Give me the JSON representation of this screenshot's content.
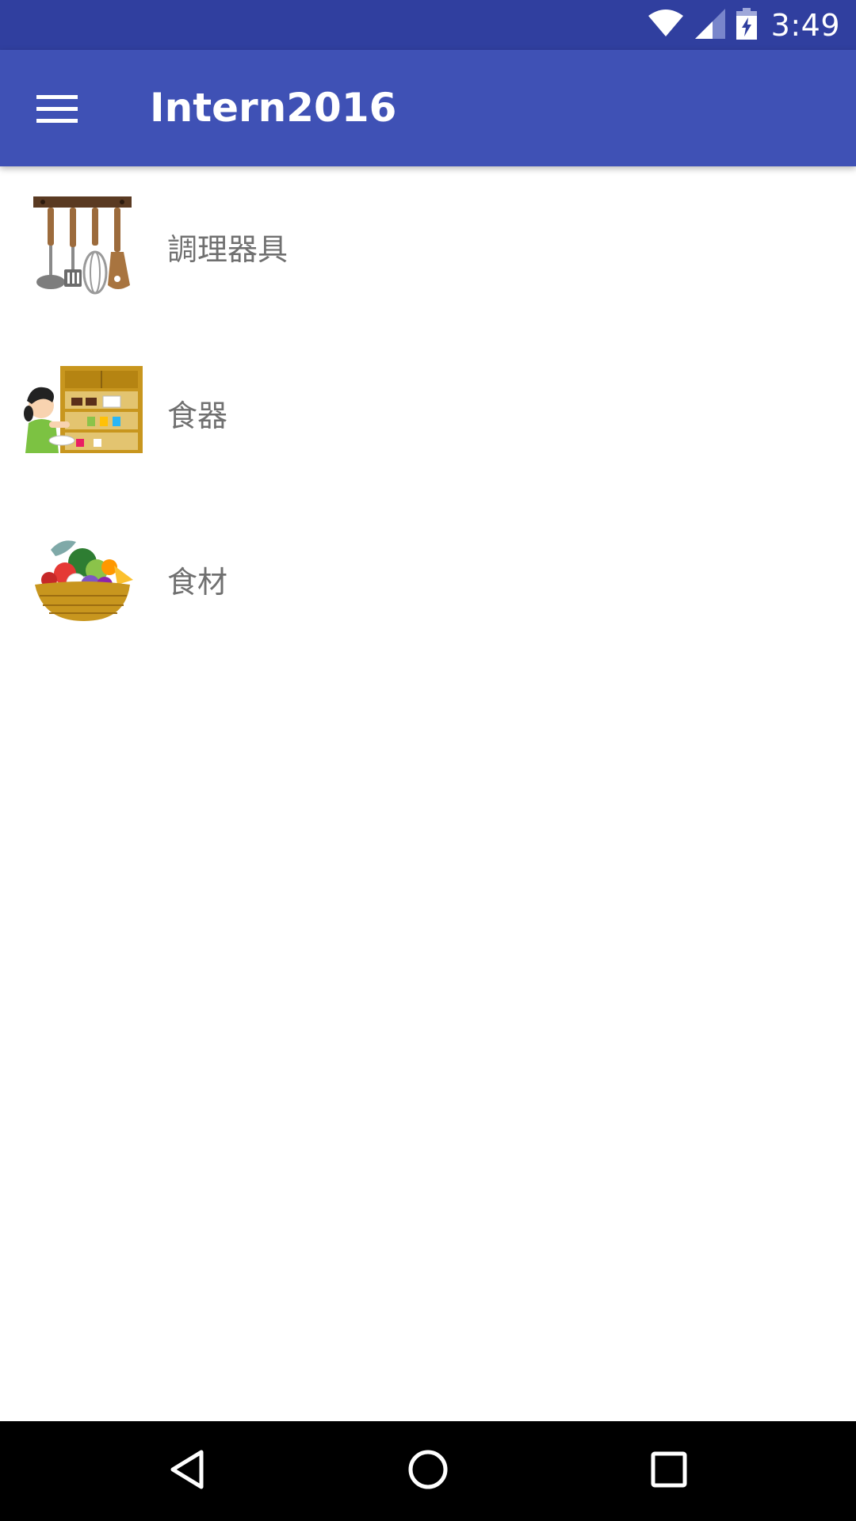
{
  "status_bar": {
    "time": "3:49",
    "icons": [
      "wifi-icon",
      "cell-signal-icon",
      "battery-charging-icon"
    ]
  },
  "app_bar": {
    "title": "Intern2016",
    "menu_icon": "hamburger-menu-icon"
  },
  "categories": [
    {
      "label": "調理器具",
      "icon": "kitchen-utensils-image"
    },
    {
      "label": "食器",
      "icon": "tableware-cupboard-image"
    },
    {
      "label": "食材",
      "icon": "food-basket-image"
    }
  ],
  "nav_bar": {
    "back_icon": "back-icon",
    "home_icon": "home-icon",
    "recents_icon": "recents-icon"
  },
  "colors": {
    "status_bar": "#303F9F",
    "app_bar": "#3F51B5",
    "label_text": "#707070",
    "nav_bar": "#000000"
  }
}
